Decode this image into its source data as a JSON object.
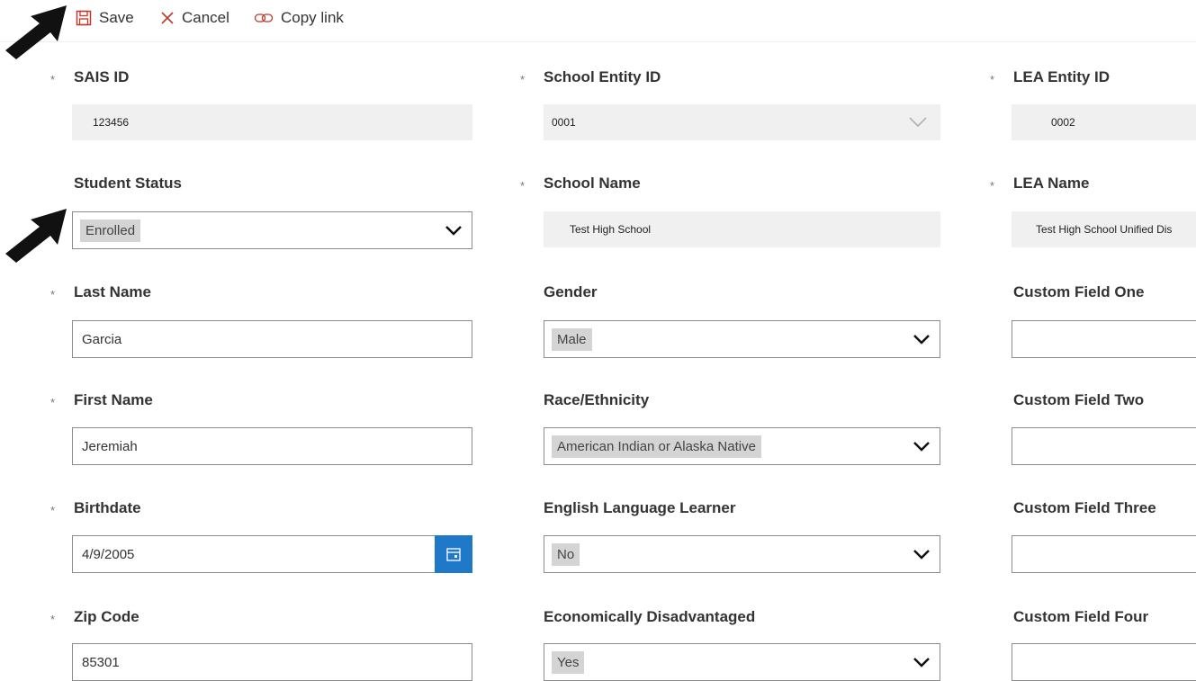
{
  "toolbar": {
    "save_label": "Save",
    "cancel_label": "Cancel",
    "copy_link_label": "Copy link",
    "save_icon": "floppy-disk-icon",
    "cancel_icon": "close-icon",
    "copy_link_icon": "link-icon",
    "accent_color": "#1f78c8"
  },
  "required_marker": "*",
  "col1": {
    "sais_id": {
      "label": "SAIS ID",
      "value": "123456"
    },
    "student_status": {
      "label": "Student Status",
      "value": "Enrolled"
    },
    "last_name": {
      "label": "Last Name",
      "value": "Garcia"
    },
    "first_name": {
      "label": "First Name",
      "value": "Jeremiah"
    },
    "birthdate": {
      "label": "Birthdate",
      "value": "4/9/2005",
      "icon": "calendar-icon"
    },
    "zip_code": {
      "label": "Zip Code",
      "value": "85301"
    }
  },
  "col2": {
    "school_entity_id": {
      "label": "School Entity ID",
      "value": "0001"
    },
    "school_name": {
      "label": "School Name",
      "value": "Test High School"
    },
    "gender": {
      "label": "Gender",
      "value": "Male"
    },
    "race_ethnicity": {
      "label": "Race/Ethnicity",
      "value": "American Indian or Alaska Native"
    },
    "ell": {
      "label": "English Language Learner",
      "value": "No"
    },
    "econ_disadvantaged": {
      "label": "Economically Disadvantaged",
      "value": "Yes"
    }
  },
  "col3": {
    "lea_entity_id": {
      "label": "LEA Entity ID",
      "value": "0002"
    },
    "lea_name": {
      "label": "LEA Name",
      "value": "Test High School Unified Dis"
    },
    "custom1": {
      "label": "Custom Field One",
      "value": ""
    },
    "custom2": {
      "label": "Custom Field Two",
      "value": ""
    },
    "custom3": {
      "label": "Custom Field Three",
      "value": ""
    },
    "custom4": {
      "label": "Custom Field Four",
      "value": ""
    }
  }
}
